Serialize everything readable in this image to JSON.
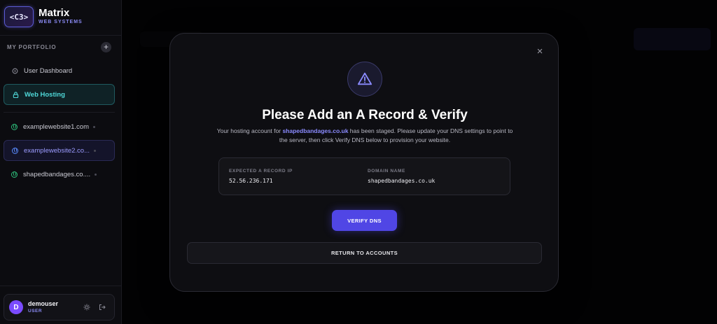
{
  "brand": {
    "logo_text": "<C3>",
    "title": "Matrix",
    "subtitle": "WEB SYSTEMS"
  },
  "sidebar": {
    "portfolio_label": "MY PORTFOLIO",
    "add_icon": "plus-icon",
    "nav": [
      {
        "label": "User Dashboard",
        "icon": "dashboard-icon",
        "active": false
      },
      {
        "label": "Web Hosting",
        "icon": "lock-icon",
        "active": true
      }
    ],
    "sites": [
      {
        "label": "examplewebsite1.com",
        "selected": false
      },
      {
        "label": "examplewebsite2.co...",
        "selected": true
      },
      {
        "label": "shapedbandages.co....",
        "selected": false
      }
    ]
  },
  "user": {
    "initial": "D",
    "name": "demouser",
    "role": "USER"
  },
  "modal": {
    "icon": "warning-icon",
    "title": "Please Add an A Record & Verify",
    "desc_prefix": "Your hosting account for ",
    "desc_domain": "shapedbandages.co.uk",
    "desc_suffix": " has been staged. Please update your DNS settings to point to the server, then click Verify DNS below to provision your website.",
    "record_ip_label": "EXPECTED A RECORD IP",
    "record_ip_value": "52.56.236.171",
    "domain_label": "DOMAIN NAME",
    "domain_value": "shapedbandages.co.uk",
    "verify_label": "VERIFY DNS",
    "return_label": "RETURN TO ACCOUNTS"
  },
  "colors": {
    "accent": "#5046e5",
    "active_nav": "#4fd8d8",
    "link": "#8b8bff"
  }
}
